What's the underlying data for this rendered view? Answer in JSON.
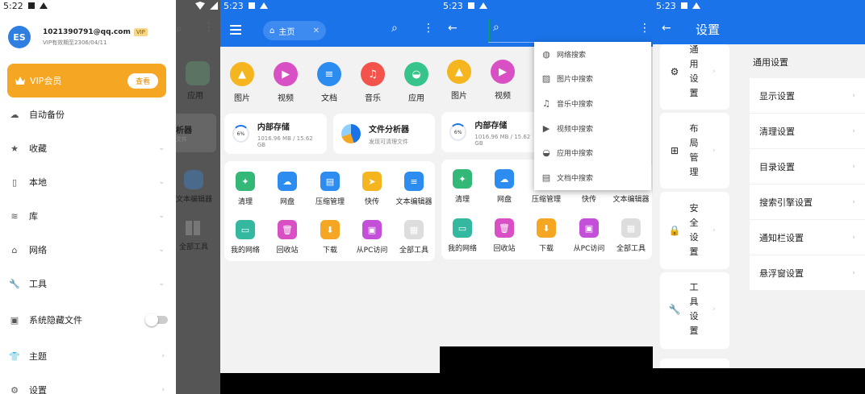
{
  "panel1": {
    "status": {
      "time": "5:22"
    },
    "user": {
      "avatar_text": "ES",
      "email": "1021390791@qq.com",
      "badge": "VIP",
      "expiry": "VIP有效期至2306/04/11"
    },
    "vip": {
      "label": "VIP会员",
      "button": "查看"
    },
    "menu": [
      {
        "label": "自动备份",
        "icon": "cloud-icon"
      },
      {
        "label": "收藏",
        "icon": "star-icon"
      },
      {
        "label": "本地",
        "icon": "phone-icon"
      },
      {
        "label": "库",
        "icon": "layers-icon"
      },
      {
        "label": "网络",
        "icon": "network-icon"
      },
      {
        "label": "工具",
        "icon": "wrench-icon"
      },
      {
        "label": "系统隐藏文件",
        "icon": "hidden-file-icon"
      },
      {
        "label": "主题",
        "icon": "shirt-icon"
      },
      {
        "label": "设置",
        "icon": "gear-icon"
      }
    ],
    "background_labels": [
      "应用",
      "析器",
      "文件",
      "文本编辑器",
      "全部工具"
    ]
  },
  "panel2": {
    "status": {
      "time": "5:23"
    },
    "tab": "主页",
    "categories": [
      "图片",
      "视频",
      "文档",
      "音乐",
      "应用"
    ],
    "storage": {
      "title": "内部存储",
      "percent": "6%",
      "size": "1016.96 MB / 15.62 GB"
    },
    "analyzer": {
      "title": "文件分析器",
      "subtitle": "发现可清理文件"
    },
    "tools": [
      "清理",
      "网盘",
      "压缩管理",
      "快传",
      "文本编辑器",
      "我的网络",
      "回收站",
      "下载",
      "从PC访问",
      "全部工具"
    ]
  },
  "panel3": {
    "status": {
      "time": "5:23"
    },
    "categories": [
      "图片",
      "视频"
    ],
    "storage": {
      "title": "内部存储",
      "percent": "6%",
      "size": "1016.96 MB / 15.62 GB"
    },
    "tools": [
      "清理",
      "网盘",
      "压缩管理",
      "快传",
      "文本编辑器",
      "我的网络",
      "回收站",
      "下载",
      "从PC访问",
      "全部工具"
    ],
    "search_menu": [
      "网络搜索",
      "图片中搜索",
      "音乐中搜索",
      "视频中搜索",
      "应用中搜索",
      "文档中搜索"
    ]
  },
  "panel4": {
    "status": {
      "time": "5:23"
    },
    "title": "设置",
    "side": [
      {
        "label": "通用设置",
        "icon": "gear-icon"
      },
      {
        "label": "布局管理",
        "icon": "layout-icon"
      },
      {
        "label": "安全设置",
        "icon": "lock-icon"
      },
      {
        "label": "工具设置",
        "icon": "wrench-icon"
      }
    ],
    "section_title": "通用设置",
    "items": [
      "显示设置",
      "清理设置",
      "目录设置",
      "搜索引擎设置",
      "通知栏设置",
      "悬浮窗设置"
    ]
  },
  "colors": {
    "primary": "#1a73e8",
    "vip": "#f5a623"
  }
}
